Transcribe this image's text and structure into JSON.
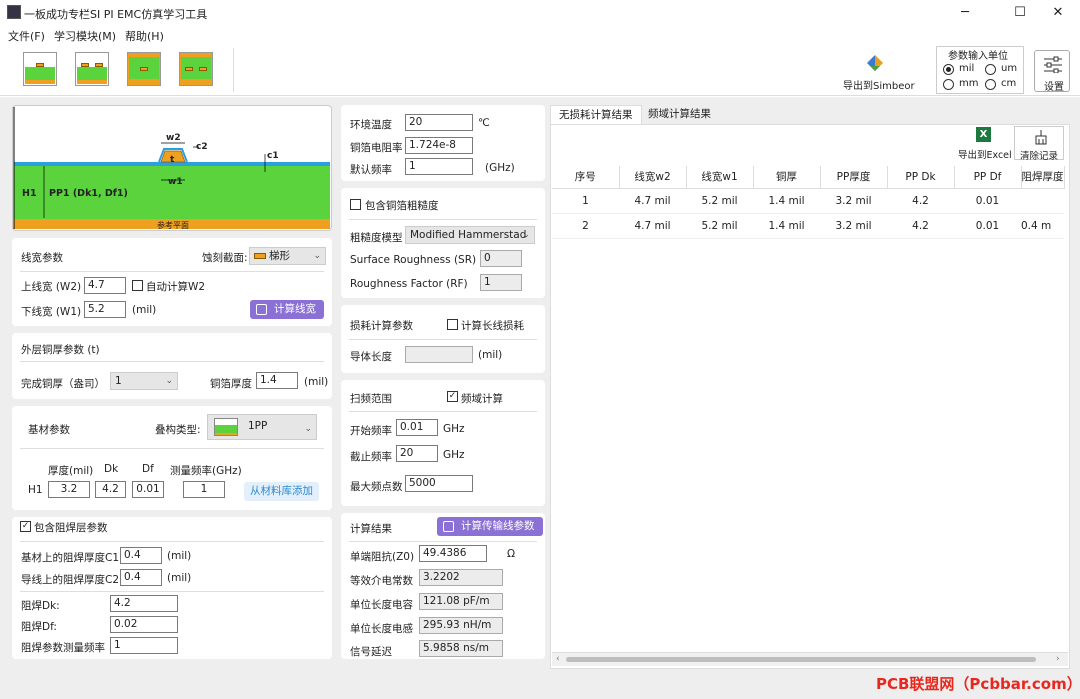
{
  "window": {
    "title": "一板成功专栏SI PI EMC仿真学习工具",
    "minimize": "─",
    "maximize": "☐",
    "close": "✕"
  },
  "menu": [
    "文件(F)",
    "学习模块(M)",
    "帮助(H)"
  ],
  "toolbar": {
    "export_simbeor": "导出到Simbeor",
    "unit_title": "参数输入单位",
    "units": [
      "mil",
      "um",
      "mm",
      "cm"
    ],
    "unit_selected": "mil",
    "settings": "设置"
  },
  "diagram": {
    "w2": "w2",
    "c2": "c2",
    "c1": "c1",
    "t": "t",
    "w1": "w1",
    "H1": "H1",
    "pp1": "PP1 (Dk1, Df1)",
    "ref_plane": "参考平面"
  },
  "line_width": {
    "title": "线宽参数",
    "etch_label": "蚀刻截面:",
    "etch_value": "梯形",
    "w2_label": "上线宽 (W2)",
    "w2_value": "4.7",
    "auto_w2": "自动计算W2",
    "w1_label": "下线宽 (W1)",
    "w1_value": "5.2",
    "unit": "(mil)",
    "calc_btn": "计算线宽"
  },
  "copper": {
    "title": "外层铜厚参数 (t)",
    "finish_label": "完成铜厚（盎司）",
    "finish_value": "1",
    "foil_label": "铜箔厚度",
    "foil_value": "1.4",
    "unit": "(mil)"
  },
  "substrate": {
    "title": "基材参数",
    "stack_label": "叠构类型:",
    "stack_value": "1PP",
    "cols": [
      "厚度(mil)",
      "Dk",
      "Df",
      "测量频率(GHz)"
    ],
    "row_label": "H1",
    "values": [
      "3.2",
      "4.2",
      "0.01",
      "1"
    ],
    "lib_btn": "从材料库添加"
  },
  "solder": {
    "include": "包含阻焊层参数",
    "c1_label": "基材上的阻焊厚度C1",
    "c1_value": "0.4",
    "c2_label": "导线上的阻焊厚度C2",
    "c2_value": "0.4",
    "unit": "(mil)",
    "dk_label": "阻焊Dk:",
    "dk_value": "4.2",
    "df_label": "阻焊Df:",
    "df_value": "0.02",
    "freq_label": "阻焊参数测量频率",
    "freq_value": "1"
  },
  "env": {
    "temp_label": "环境温度",
    "temp_value": "20",
    "temp_unit": "℃",
    "res_label": "铜箔电阻率",
    "res_value": "1.724e-8",
    "freq_label": "默认频率",
    "freq_value": "1",
    "freq_unit": "(GHz)"
  },
  "rough": {
    "include": "包含铜箔粗糙度",
    "model_label": "粗糙度模型",
    "model_value": "Modified Hammerstad",
    "sr_label": "Surface Roughness (SR)",
    "sr_value": "0",
    "rf_label": "Roughness Factor (RF)",
    "rf_value": "1"
  },
  "loss": {
    "title": "损耗计算参数",
    "long_loss": "计算长线损耗",
    "len_label": "导体长度",
    "len_value": "",
    "unit": "(mil)"
  },
  "sweep": {
    "title": "扫频范围",
    "freq_domain": "频域计算",
    "start_label": "开始频率",
    "start_value": "0.01",
    "stop_label": "截止频率",
    "stop_value": "20",
    "unit": "GHz",
    "max_label": "最大频点数",
    "max_value": "5000"
  },
  "results": {
    "title": "计算结果",
    "calc_btn": "计算传输线参数",
    "z0_label": "单端阻抗(Z0)",
    "z0_value": "49.4386",
    "z0_unit": "Ω",
    "eps_label": "等效介电常数",
    "eps_value": "3.2202",
    "cap_label": "单位长度电容",
    "cap_value": "121.08 pF/m",
    "ind_label": "单位长度电感",
    "ind_value": "295.93 nH/m",
    "delay_label": "信号延迟",
    "delay_value": "5.9858 ns/m"
  },
  "tabs": [
    "无损耗计算结果",
    "频域计算结果"
  ],
  "table_tools": {
    "export_excel": "导出到Excel",
    "clear": "清除记录"
  },
  "table": {
    "headers": [
      "序号",
      "线宽w2",
      "线宽w1",
      "铜厚",
      "PP厚度",
      "PP Dk",
      "PP Df",
      "阻焊厚度"
    ],
    "rows": [
      [
        "1",
        "4.7 mil",
        "5.2 mil",
        "1.4 mil",
        "3.2 mil",
        "4.2",
        "0.01",
        ""
      ],
      [
        "2",
        "4.7 mil",
        "5.2 mil",
        "1.4 mil",
        "3.2 mil",
        "4.2",
        "0.01",
        "0.4 m"
      ]
    ]
  },
  "watermark": "PCB联盟网（Pcbbar.com）"
}
